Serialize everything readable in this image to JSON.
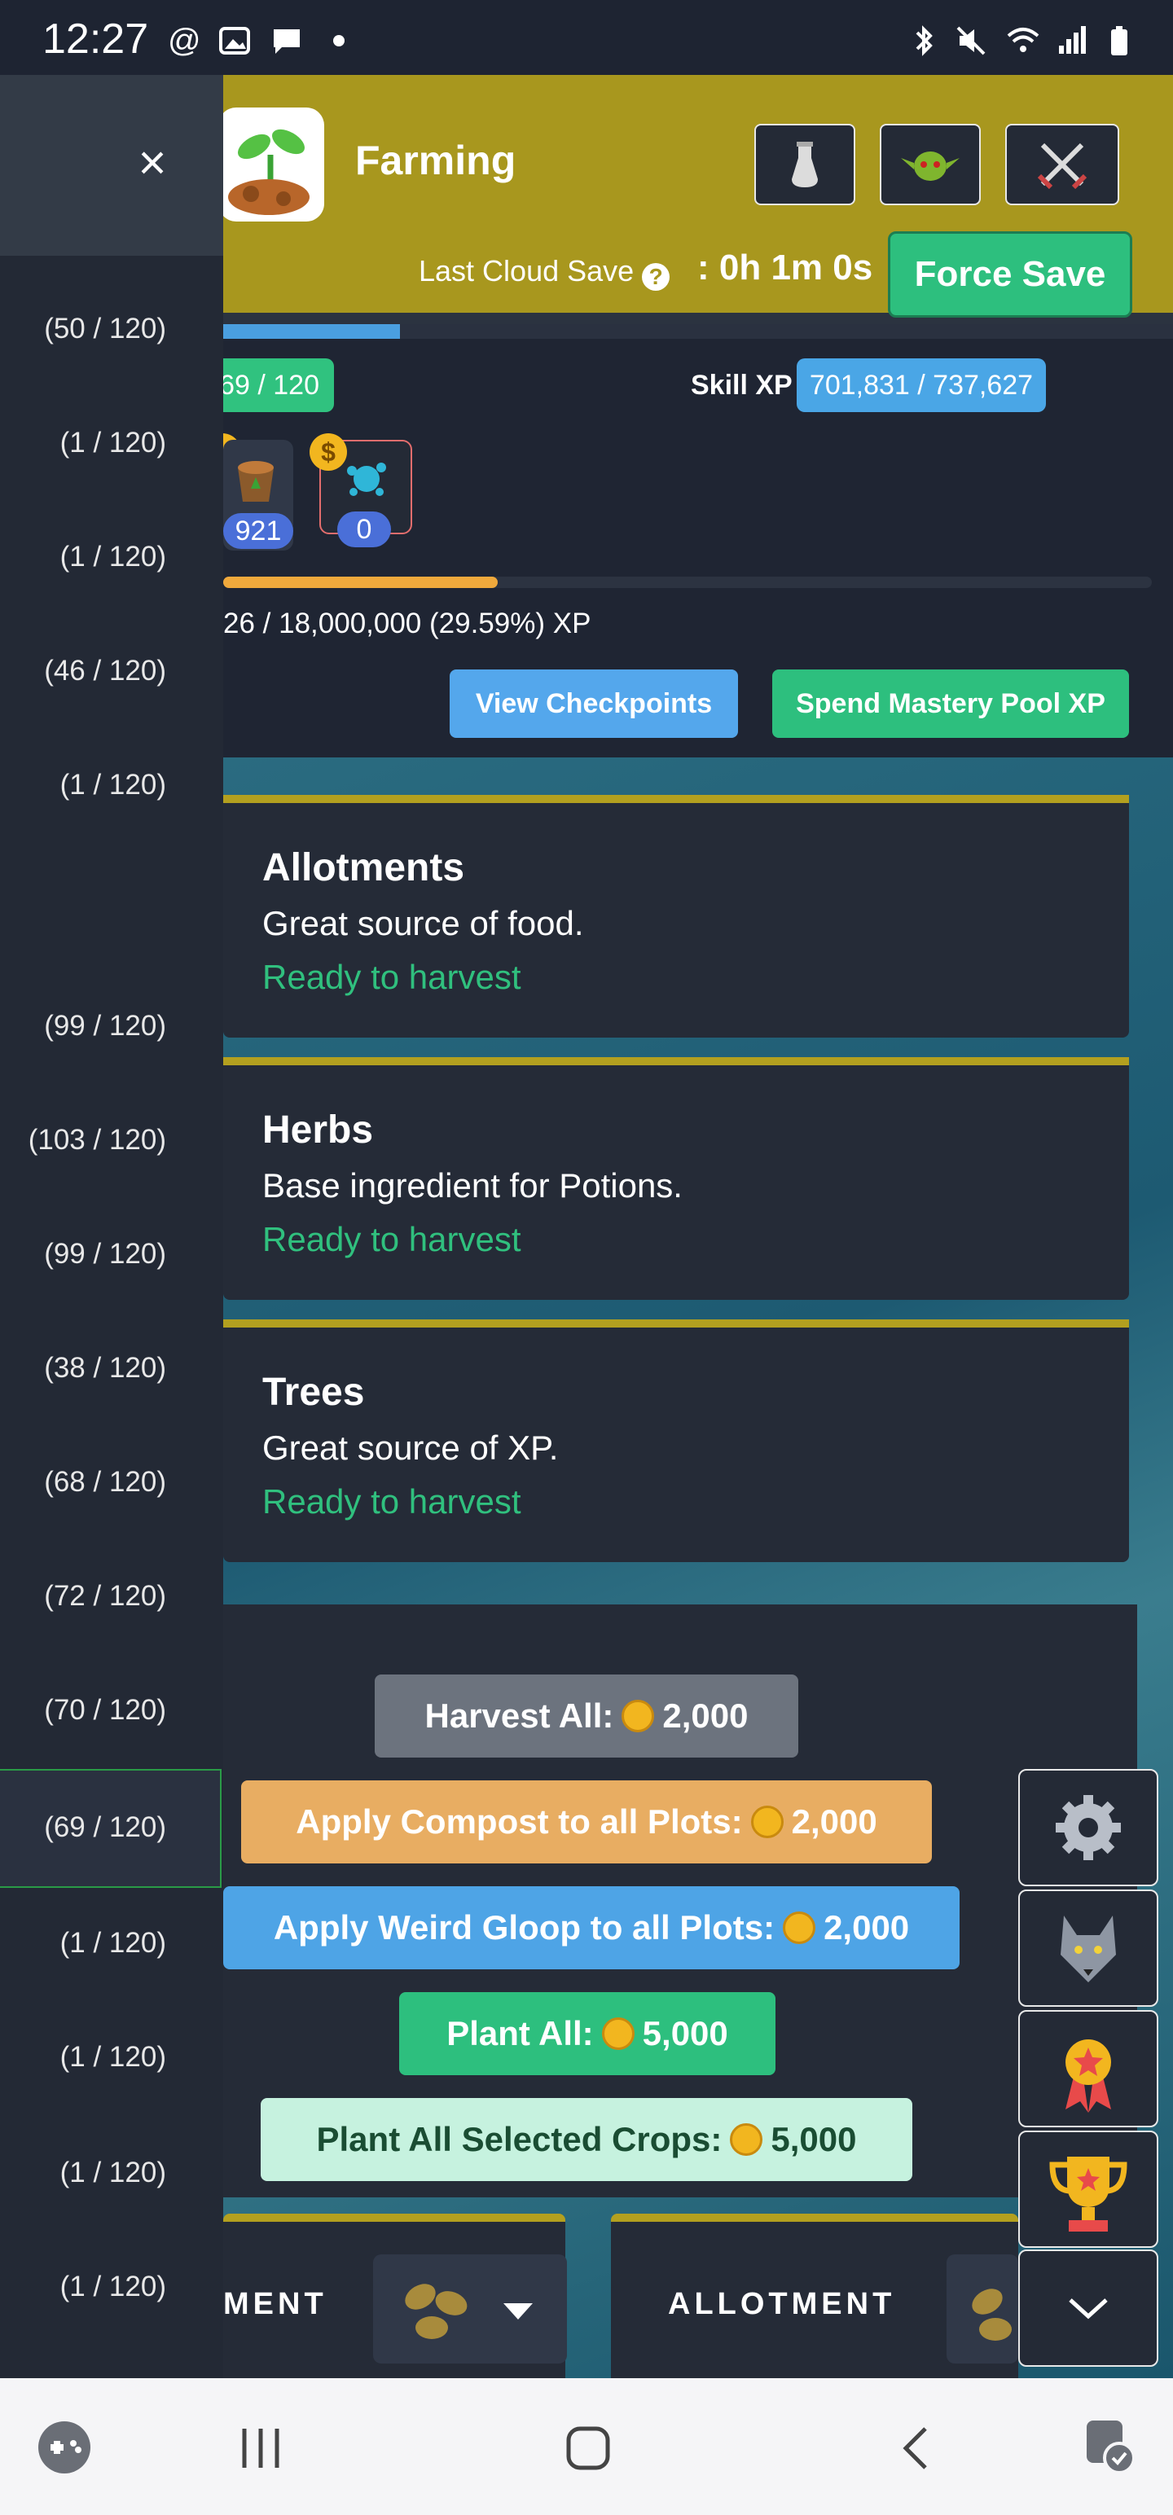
{
  "status_bar": {
    "time": "12:27",
    "left_icons": [
      "threads-icon",
      "gallery-icon",
      "message-icon",
      "dot-icon"
    ],
    "right_icons": [
      "bluetooth-icon",
      "mute-icon",
      "wifi-icon",
      "signal-icon",
      "battery-icon"
    ]
  },
  "header": {
    "title": "Farming",
    "cloud_save_label": "Last Cloud Save",
    "cloud_save_value": ": 0h 1m 0s",
    "force_save": "Force Save",
    "icon_buttons": [
      "potion-icon",
      "goblin-icon",
      "crossed-swords-icon"
    ],
    "accent": "#a8971e"
  },
  "skill": {
    "level": "69 / 120",
    "xp_label": "Skill XP",
    "xp_value": "701,831 / 737,627",
    "xp_progress": 0.186
  },
  "items": [
    {
      "icon": "compost-bucket-icon",
      "count": "921"
    },
    {
      "icon": "weird-gloop-icon",
      "count": "0"
    }
  ],
  "mastery": {
    "text": "26 / 18,000,000 (29.59%) XP",
    "progress": 0.2959,
    "view_checkpoints": "View Checkpoints",
    "spend_pool": "Spend Mastery Pool XP"
  },
  "categories": [
    {
      "title": "Allotments",
      "desc": "Great source of food.",
      "status": "Ready to harvest"
    },
    {
      "title": "Herbs",
      "desc": "Base ingredient for Potions.",
      "status": "Ready to harvest"
    },
    {
      "title": "Trees",
      "desc": "Great source of XP.",
      "status": "Ready to harvest"
    }
  ],
  "actions": {
    "harvest_all": "Harvest All:",
    "harvest_all_cost": "2,000",
    "apply_compost": "Apply Compost to all Plots:",
    "apply_compost_cost": "2,000",
    "apply_gloop": "Apply Weird Gloop to all Plots:",
    "apply_gloop_cost": "2,000",
    "plant_all": "Plant All:",
    "plant_all_cost": "5,000",
    "plant_selected": "Plant All Selected Crops:",
    "plant_selected_cost": "5,000"
  },
  "plots": [
    {
      "label": "MENT"
    },
    {
      "label": "ALLOTMENT"
    }
  ],
  "quick_menu": [
    "gear-icon",
    "wolf-icon",
    "medal-icon",
    "trophy-icon",
    "chevron-down-icon"
  ],
  "drawer": {
    "close": "×",
    "counts": [
      "(50 / 120)",
      "(1 / 120)",
      "(1 / 120)",
      "(46 / 120)",
      "(1 / 120)",
      "(99 / 120)",
      "(103 / 120)",
      "(99 / 120)",
      "(38 / 120)",
      "(68 / 120)",
      "(72 / 120)",
      "(70 / 120)",
      "(69 / 120)",
      "(1 / 120)",
      "(1 / 120)",
      "(1 / 120)",
      "(1 / 120)"
    ]
  },
  "nav_bar": [
    "game-launcher-icon",
    "recents-icon",
    "home-icon",
    "back-icon",
    "assistant-icon"
  ]
}
